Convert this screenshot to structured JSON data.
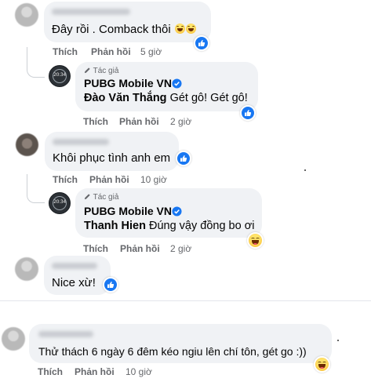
{
  "actions": {
    "like": "Thích",
    "reply": "Phản hồi"
  },
  "page_author_badge": "Tác giả",
  "page_avatar_text": "20:34",
  "comments": [
    {
      "text": "Đây rồi . Comback thôi",
      "time": "5 giờ",
      "reaction": "like-icon"
    },
    {
      "reply_name": "PUBG Mobile VN",
      "tagged": "Đào Văn Thắng",
      "text": "Gét gô! Gét gô!",
      "time": "2 giờ",
      "reaction": "like-icon"
    },
    {
      "text": "Khôi phục tình anh em",
      "time": "10 giờ",
      "reaction": "like-icon"
    },
    {
      "reply_name": "PUBG Mobile VN",
      "tagged": "Thanh Hien",
      "text": "Đúng vậy đồng bo ơi",
      "time": "2 giờ",
      "reaction": "haha-icon"
    },
    {
      "text": "Nice xừ!",
      "reaction": "like-icon"
    },
    {
      "text": "Thử thách 6 ngày 6 đêm kéo ngiu lên chí tôn, gét go :))",
      "time": "10 giờ",
      "reaction": "haha-icon"
    }
  ],
  "colors": {
    "like_blue": "#1877f2",
    "bubble": "#f0f2f5",
    "meta_gray": "#65676b"
  }
}
